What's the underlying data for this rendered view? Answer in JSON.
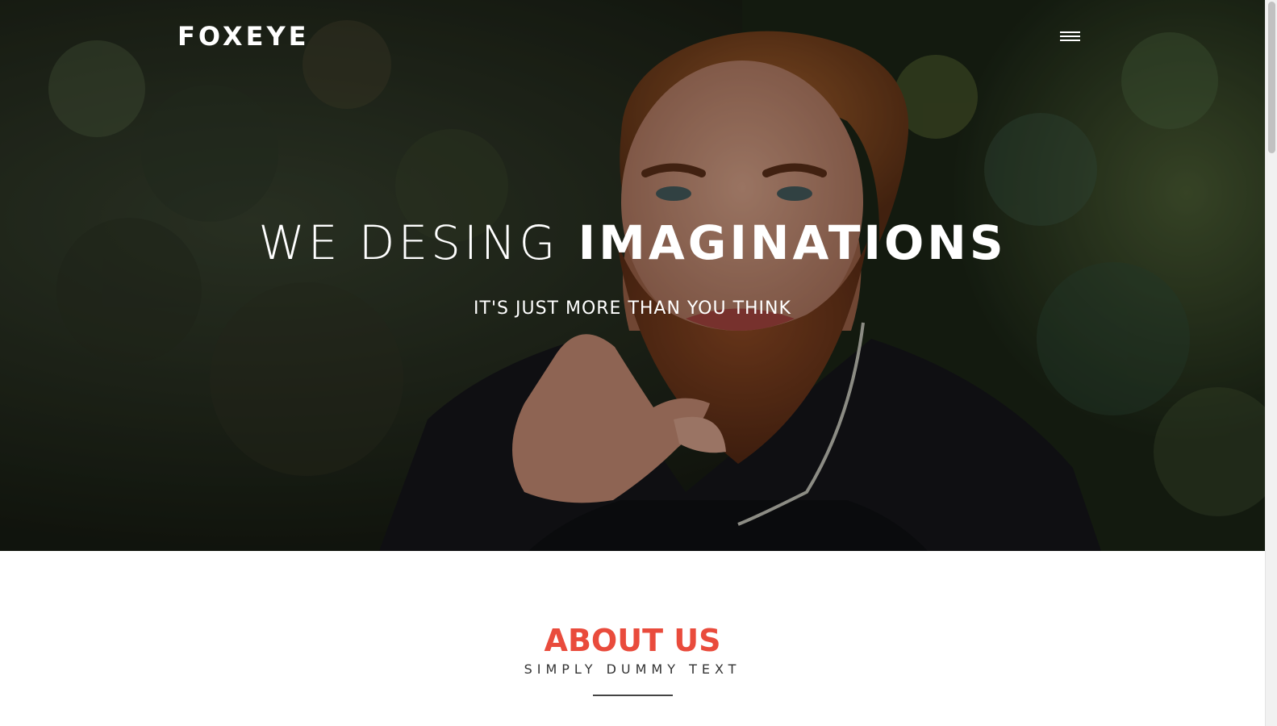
{
  "brand": {
    "name": "FOXEYE"
  },
  "nav": {
    "menu_icon": "hamburger-menu-icon"
  },
  "hero": {
    "title_light": "WE DESING",
    "title_bold": "IMAGINATIONS",
    "subtitle": "IT'S JUST MORE THAN YOU THINK",
    "image": "bearded-man-portrait-photo"
  },
  "about": {
    "title": "ABOUT US",
    "subtitle": "SIMPLY DUMMY TEXT"
  },
  "colors": {
    "accent": "#e94b3c",
    "hero_text": "#ffffff"
  }
}
